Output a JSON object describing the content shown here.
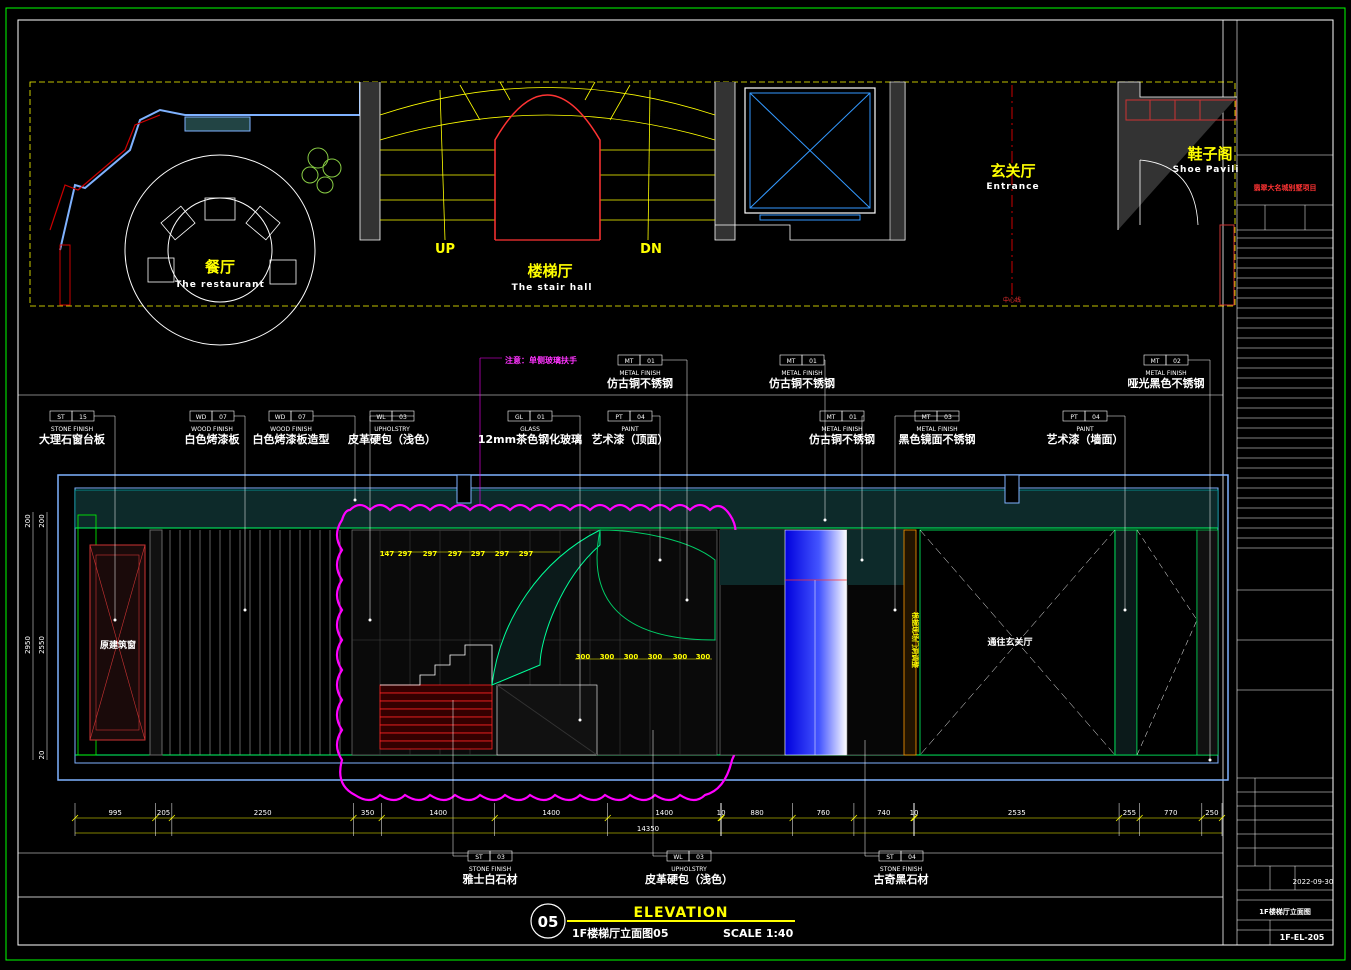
{
  "plan": {
    "rooms": {
      "restaurant_cn": "餐厅",
      "restaurant_en": "The restaurant",
      "stair_cn": "楼梯厅",
      "stair_en": "The stair hall",
      "entrance_cn": "玄关厅",
      "entrance_en": "Entrance",
      "shoe_cn": "鞋子阁",
      "shoe_en": "Shoe Pavili"
    },
    "up_label": "UP",
    "dn_label": "DN",
    "axis_label": "中心线"
  },
  "note": "注意：单侧玻璃扶手",
  "tags_top": [
    {
      "code1": "MT",
      "code2": "01",
      "sub": "METAL FINISH",
      "label": "仿古铜不锈钢"
    },
    {
      "code1": "MT",
      "code2": "01",
      "sub": "METAL FINISH",
      "label": "仿古铜不锈钢"
    },
    {
      "code1": "MT",
      "code2": "02",
      "sub": "METAL FINISH",
      "label": "哑光黑色不锈钢"
    }
  ],
  "tags_mid": [
    {
      "code1": "ST",
      "code2": "15",
      "sub": "STONE FINISH",
      "label": "大理石窗台板"
    },
    {
      "code1": "WD",
      "code2": "07",
      "sub": "WOOD FINISH",
      "label": "白色烤漆板"
    },
    {
      "code1": "WD",
      "code2": "07",
      "sub": "WOOD FINISH",
      "label": "白色烤漆板造型"
    },
    {
      "code1": "WL",
      "code2": "03",
      "sub": "UPHOLSTRY",
      "label": "皮革硬包（浅色）"
    },
    {
      "code1": "GL",
      "code2": "01",
      "sub": "GLASS",
      "label": "12mm茶色钢化玻璃"
    },
    {
      "code1": "PT",
      "code2": "04",
      "sub": "PAINT",
      "label": "艺术漆（顶面）"
    },
    {
      "code1": "MT",
      "code2": "01",
      "sub": "METAL FINISH",
      "label": "仿古铜不锈钢"
    },
    {
      "code1": "MT",
      "code2": "03",
      "sub": "METAL FINISH",
      "label": "黑色镜面不锈钢"
    },
    {
      "code1": "PT",
      "code2": "04",
      "sub": "PAINT",
      "label": "艺术漆（墙面）"
    }
  ],
  "tags_bottom": [
    {
      "code1": "ST",
      "code2": "03",
      "sub": "STONE FINISH",
      "label": "雅士白石材"
    },
    {
      "code1": "WL",
      "code2": "03",
      "sub": "UPHOLSTRY",
      "label": "皮革硬包（浅色）"
    },
    {
      "code1": "ST",
      "code2": "04",
      "sub": "STONE FINISH",
      "label": "古奇黑石材"
    }
  ],
  "elevation_text": {
    "window": "原建筑窗",
    "entrance": "通往玄关厅",
    "door_note": "根据现场门洞调整",
    "stair_widths": [
      "147",
      "297",
      "297",
      "297",
      "297",
      "297",
      "297"
    ],
    "riser_widths": [
      "300",
      "300",
      "300",
      "300",
      "300",
      "300"
    ]
  },
  "left_dims": [
    "200",
    "200",
    "2950",
    "2550",
    "20"
  ],
  "dimensions": [
    "995",
    "205",
    "2250",
    "350",
    "1400",
    "1400",
    "1400",
    "10",
    "880",
    "760",
    "740",
    "10",
    "2535",
    "255",
    "770",
    "250"
  ],
  "total_dimension": "14350",
  "title": {
    "number": "05",
    "heading": "ELEVATION",
    "subtitle": "1F楼梯厅立面图05",
    "scale": "SCALE 1:40"
  },
  "titleblock": {
    "project_name": "翡翠大名城别墅项目",
    "date": "2022-09-30",
    "drawing_title": "1F楼梯厅立面图",
    "drawing_no": "1F-EL-205"
  }
}
